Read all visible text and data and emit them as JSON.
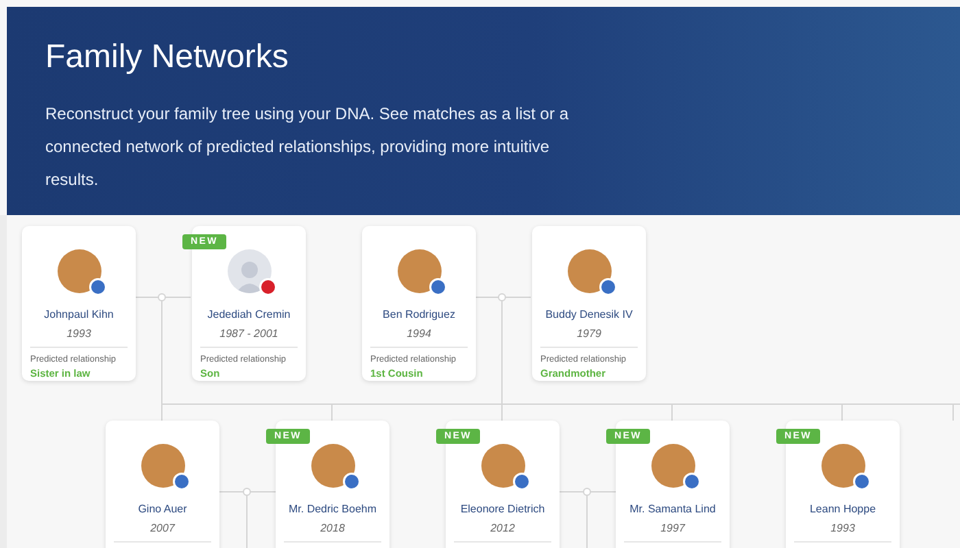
{
  "header": {
    "title": "Family Networks",
    "description": "Reconstruct your family tree using your DNA. See matches as a list or a connected network of predicted relationships, providing more intuitive results."
  },
  "generations": [
    {
      "cards": [
        {
          "name": "Johnpaul Kihn",
          "years": "1993",
          "kind": "photo",
          "new": false,
          "label": "Predicted relationship",
          "relationship": "Sister in law"
        },
        {
          "name": "Jedediah Cremin",
          "years": "1987 - 2001",
          "kind": "silhouette",
          "new": true,
          "badge": "NEW",
          "label": "Predicted relationship",
          "relationship": "Son"
        },
        {
          "name": "Ben Rodriguez",
          "years": "1994",
          "kind": "photo",
          "new": false,
          "label": "Predicted relationship",
          "relationship": "1st Cousin"
        },
        {
          "name": "Buddy Denesik IV",
          "years": "1979",
          "kind": "photo",
          "new": false,
          "label": "Predicted relationship",
          "relationship": "Grandmother"
        }
      ]
    },
    {
      "cards": [
        {
          "name": "Gino Auer",
          "years": "2007",
          "kind": "photo",
          "new": false
        },
        {
          "name": "Mr. Dedric Boehm",
          "years": "2018",
          "kind": "photo",
          "new": true,
          "badge": "NEW"
        },
        {
          "name": "Eleonore Dietrich",
          "years": "2012",
          "kind": "photo",
          "new": true,
          "badge": "NEW"
        },
        {
          "name": "Mr. Samanta Lind",
          "years": "1997",
          "kind": "photo",
          "new": true,
          "badge": "NEW"
        },
        {
          "name": "Leann Hoppe",
          "years": "1993",
          "kind": "photo",
          "new": true,
          "badge": "NEW"
        }
      ]
    }
  ]
}
